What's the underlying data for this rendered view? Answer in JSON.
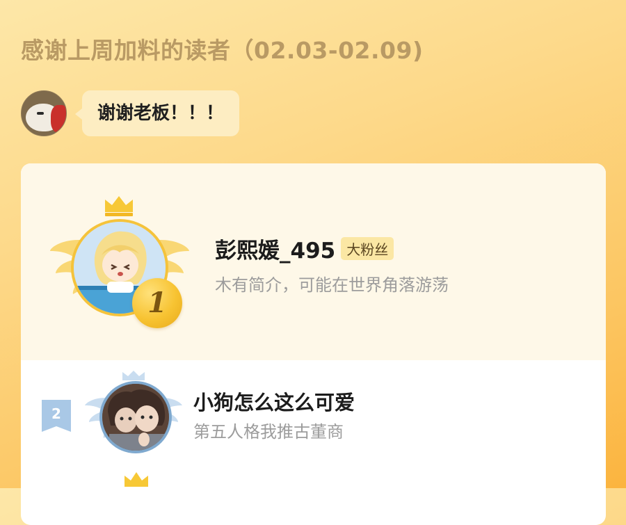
{
  "header": {
    "title": "感谢上周加料的读者（02.03-02.09)"
  },
  "author_message": {
    "text": "谢谢老板！！！"
  },
  "ranking": [
    {
      "rank": "1",
      "name": "彭熙媛_495",
      "badge": "大粉丝",
      "bio": "木有简介，可能在世界角落游荡"
    },
    {
      "rank": "2",
      "name": "小狗怎么这么可爱",
      "bio": "第五人格我推古董商"
    }
  ],
  "colors": {
    "gold": "#f5c33b",
    "silver_blue": "#7fa9cf",
    "title": "#b99a64"
  },
  "icons": [
    "crown-icon",
    "wings-icon",
    "rank-badge-icon"
  ]
}
